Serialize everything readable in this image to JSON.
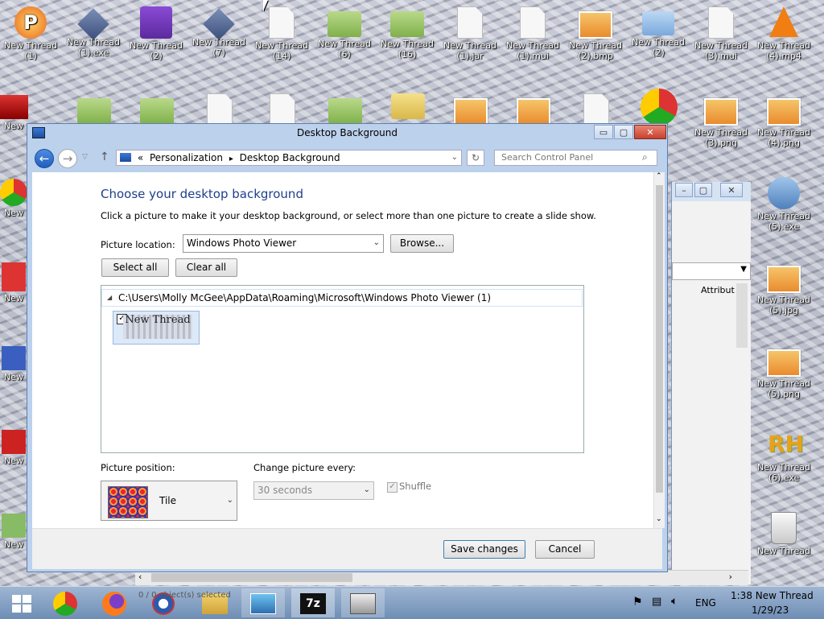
{
  "desktop": {
    "icons_row1": [
      {
        "label": "New Thread\n(1)",
        "icon": "app-p-icon"
      },
      {
        "label": "New Thread\n(1).exe",
        "icon": "diamond-icon"
      },
      {
        "label": "New Thread\n(2)",
        "icon": "visual-studio-icon"
      },
      {
        "label": "New Thread\n(7)",
        "icon": "diamond-icon"
      },
      {
        "label": "New Thread\n(14)",
        "icon": "file-icon"
      },
      {
        "label": "New Thread\n(6)",
        "icon": "folder-icon"
      },
      {
        "label": "New Thread\n(16)",
        "icon": "folder-icon"
      },
      {
        "label": "New Thread\n(1).jar",
        "icon": "file-icon"
      },
      {
        "label": "New Thread\n(1).mui",
        "icon": "file-icon"
      },
      {
        "label": "New Thread\n(2).bmp",
        "icon": "picture-icon"
      },
      {
        "label": "New Thread\n(2)",
        "icon": "search-app-icon"
      },
      {
        "label": "New Thread\n(3).mui",
        "icon": "file-icon"
      },
      {
        "label": "New Thread\n(4).mp4",
        "icon": "vlc-icon"
      }
    ],
    "icons_right": [
      {
        "label": "New Thread\n(3).png",
        "icon": "picture-icon"
      },
      {
        "label": "New Thread\n(4).png",
        "icon": "picture-icon"
      },
      {
        "label": "New Thread\n(5).exe",
        "icon": "installer-icon"
      },
      {
        "label": "New Thread\n(5).jpg",
        "icon": "picture-icon"
      },
      {
        "label": "New Thread\n(5).png",
        "icon": "picture-icon"
      },
      {
        "label": "New Thread\n(6).exe",
        "icon": "rh-icon"
      },
      {
        "label": "New Thread",
        "icon": "recycle-bin-icon"
      }
    ],
    "left_edge_labels": [
      "New",
      "New",
      "New",
      "New",
      "New",
      "New"
    ]
  },
  "window": {
    "title": "Desktop Background",
    "minimize": "▭",
    "maximize": "▢",
    "close": "✕",
    "address": {
      "prefix": "«",
      "crumb1": "Personalization",
      "sep": "▸",
      "crumb2": "Desktop Background"
    },
    "search_placeholder": "Search Control Panel",
    "heading": "Choose your desktop background",
    "subtitle": "Click a picture to make it your desktop background, or select more than one picture to create a slide show.",
    "picture_location_label": "Picture location:",
    "picture_location_value": "Windows Photo Viewer",
    "browse_label": "Browse...",
    "select_all_label": "Select all",
    "clear_all_label": "Clear all",
    "group_path": "C:\\Users\\Molly McGee\\AppData\\Roaming\\Microsoft\\Windows Photo Viewer (1)",
    "thumbnail_text": "New Thread",
    "thumbnail_checked": true,
    "picture_position_label": "Picture position:",
    "picture_position_value": "Tile",
    "change_every_label": "Change picture every:",
    "change_every_value": "30 seconds",
    "shuffle_label": "Shuffle",
    "shuffle_checked": true,
    "save_label": "Save changes",
    "cancel_label": "Cancel"
  },
  "background_window": {
    "attribute_header": "Attribut",
    "status_text": "0 / 0 object(s) selected"
  },
  "taskbar": {
    "lang": "ENG",
    "time": "1:38 New Thread",
    "date": "1/29/23"
  },
  "colors": {
    "accent": "#1e3f8c",
    "window_frame": "#bcd1ec",
    "close_red": "#c8412c",
    "taskbar": "#6e8db5"
  }
}
